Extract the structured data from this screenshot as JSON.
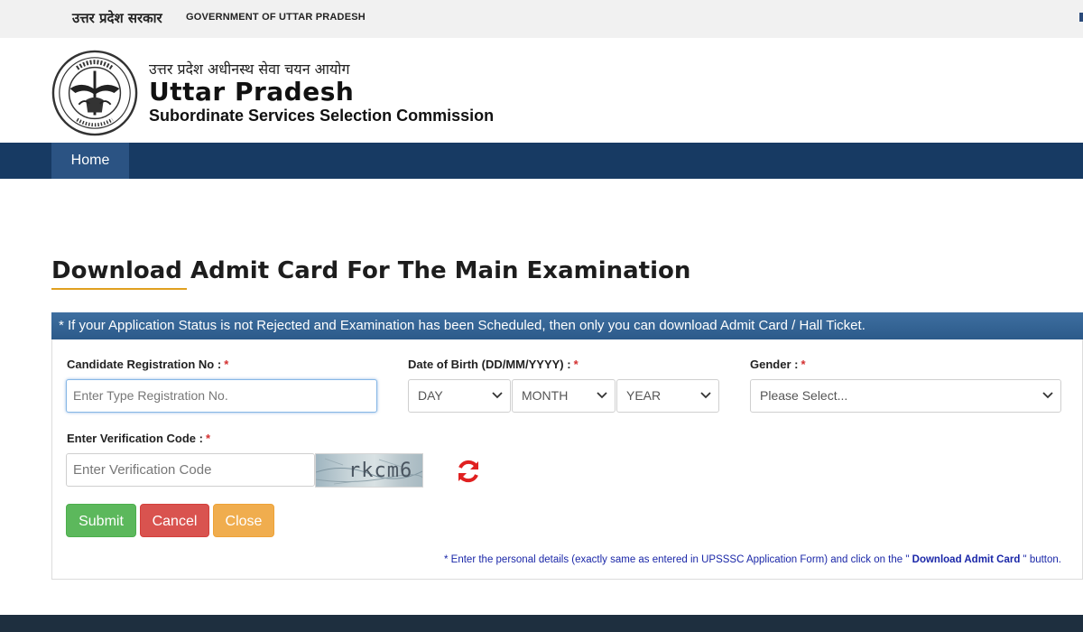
{
  "topbar": {
    "hindi_label": "उत्तर प्रदेश सरकार",
    "english_label": "GOVERNMENT OF UTTAR PRADESH"
  },
  "header": {
    "org_hindi": "उत्तर प्रदेश अधीनस्थ सेवा चयन आयोग",
    "org_name": "Uttar Pradesh",
    "org_subtitle": "Subordinate Services Selection Commission",
    "emblem_text": "उत्तर प्रदेश सरकार"
  },
  "nav": {
    "items": [
      {
        "label": "Home"
      }
    ]
  },
  "main": {
    "title": "Download Admit Card For The Main Examination",
    "notice": "* If your Application Status is not Rejected and Examination has been Scheduled, then only you can download Admit Card / Hall Ticket."
  },
  "form": {
    "registration": {
      "label": "Candidate Registration No :",
      "required": "*",
      "placeholder": "Enter Type Registration No."
    },
    "dob": {
      "label": "Date of Birth (DD/MM/YYYY) :",
      "required": "*",
      "day": "DAY",
      "month": "MONTH",
      "year": "YEAR"
    },
    "gender": {
      "label": "Gender :",
      "required": "*",
      "selected": "Please Select..."
    },
    "verification": {
      "label": "Enter Verification Code :",
      "required": "*",
      "placeholder": "Enter Verification Code"
    },
    "captcha_text": "rkcm6"
  },
  "buttons": {
    "submit": "Submit",
    "cancel": "Cancel",
    "close": "Close"
  },
  "hint": {
    "prefix": "* Enter the personal details (exactly same as entered in UPSSSC Application Form) and click on the \"",
    "bold": "Download Admit Card",
    "suffix": "\" button."
  },
  "colors": {
    "nav_bg": "#173a63",
    "notice_bg": "#3e6fa0",
    "submit": "#5cb85c",
    "cancel": "#d9534f",
    "close": "#f0ad4e",
    "required": "#d32f2f",
    "hint_text": "#1a27a8"
  },
  "icons": {
    "emblem": "up-government-emblem-icon",
    "refresh": "refresh-icon",
    "chevron": "chevron-down-icon"
  }
}
